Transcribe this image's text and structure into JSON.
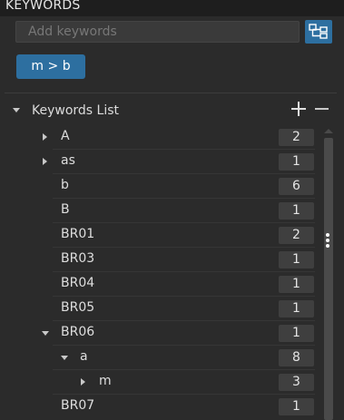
{
  "panel": {
    "title": "KEYWORDS",
    "input_placeholder": "Add keywords",
    "active_chip": "m > b"
  },
  "tree": {
    "header_label": "Keywords List",
    "items": [
      {
        "label": "A",
        "count": "2",
        "depth": 1,
        "expander": "collapsed"
      },
      {
        "label": "as",
        "count": "1",
        "depth": 1,
        "expander": "collapsed"
      },
      {
        "label": "b",
        "count": "6",
        "depth": 1,
        "expander": "none"
      },
      {
        "label": "B",
        "count": "1",
        "depth": 1,
        "expander": "none"
      },
      {
        "label": "BR01",
        "count": "2",
        "depth": 1,
        "expander": "none"
      },
      {
        "label": "BR03",
        "count": "1",
        "depth": 1,
        "expander": "none"
      },
      {
        "label": "BR04",
        "count": "1",
        "depth": 1,
        "expander": "none"
      },
      {
        "label": "BR05",
        "count": "1",
        "depth": 1,
        "expander": "none"
      },
      {
        "label": "BR06",
        "count": "1",
        "depth": 1,
        "expander": "expanded"
      },
      {
        "label": "a",
        "count": "8",
        "depth": 2,
        "expander": "expanded"
      },
      {
        "label": "m",
        "count": "3",
        "depth": 3,
        "expander": "collapsed"
      },
      {
        "label": "BR07",
        "count": "1",
        "depth": 1,
        "expander": "none"
      }
    ]
  },
  "colors": {
    "accent": "#2d6fa0",
    "background": "#2b2b2b",
    "count_badge": "#3f3f3f"
  },
  "icons": {
    "view_toggle": "hierarchy-icon",
    "add": "plus-icon",
    "remove": "minus-icon",
    "more": "vertical-ellipsis-icon"
  }
}
